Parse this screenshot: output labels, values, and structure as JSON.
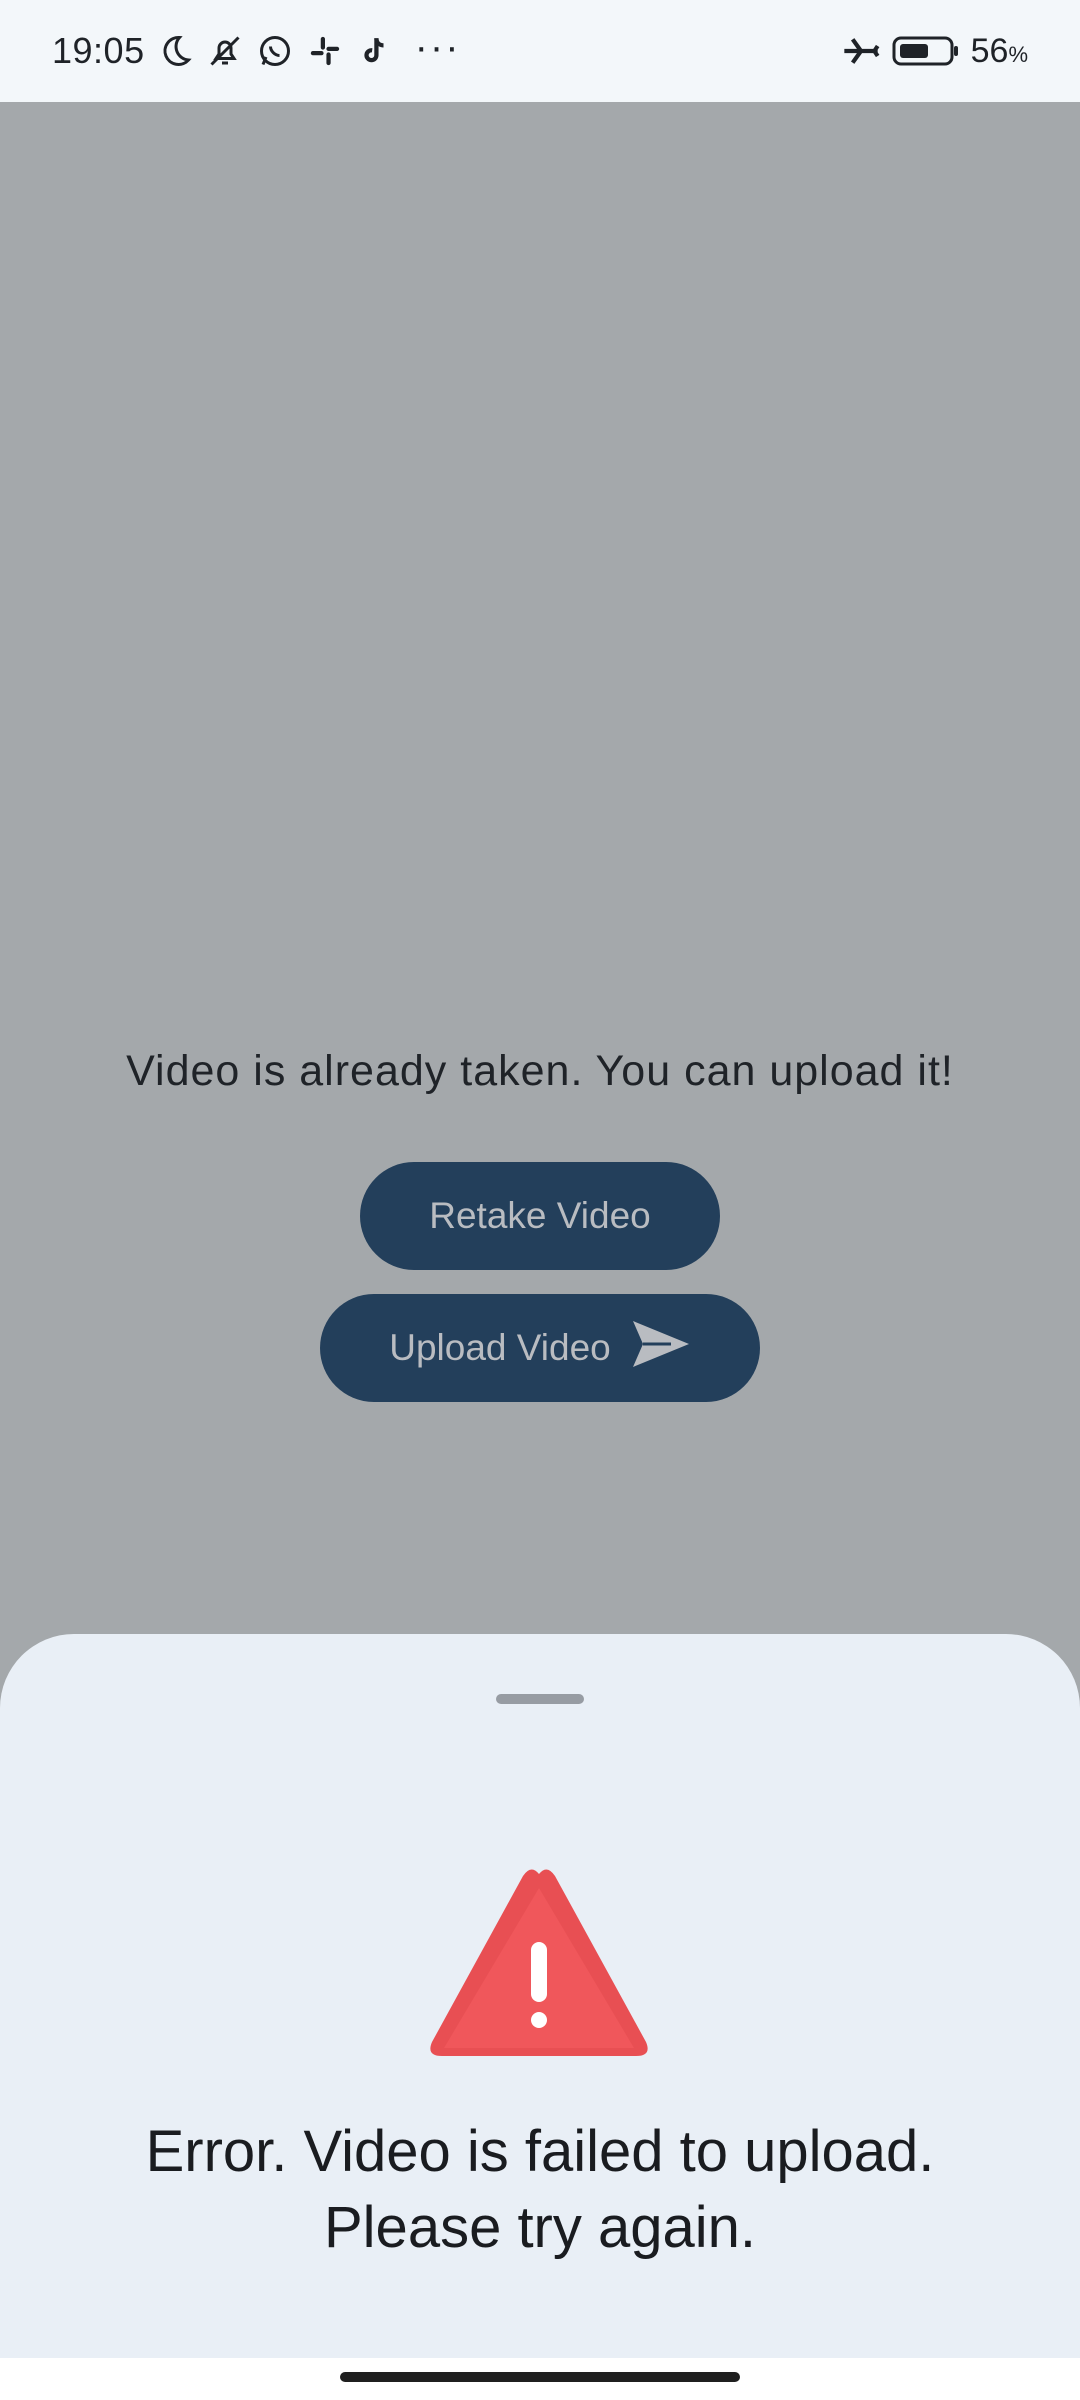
{
  "status_bar": {
    "time": "19:05",
    "left_icons": [
      "moon-icon",
      "bell-off-icon",
      "whatsapp-icon",
      "slack-icon",
      "tiktok-icon"
    ],
    "more": "···",
    "right_icons": [
      "airplane-icon",
      "battery-icon"
    ],
    "battery_percent": "56",
    "battery_unit": "%"
  },
  "main": {
    "message": "Video is already taken. You can upload it!",
    "retake_label": "Retake Video",
    "upload_label": "Upload Video"
  },
  "sheet": {
    "error_line1": "Error. Video is failed to upload.",
    "error_line2": "Please try again."
  },
  "colors": {
    "button_bg": "#233f5b",
    "overlay_bg": "#a4a8ab",
    "sheet_bg": "#e9eff6",
    "warning_red": "#f0575b"
  }
}
